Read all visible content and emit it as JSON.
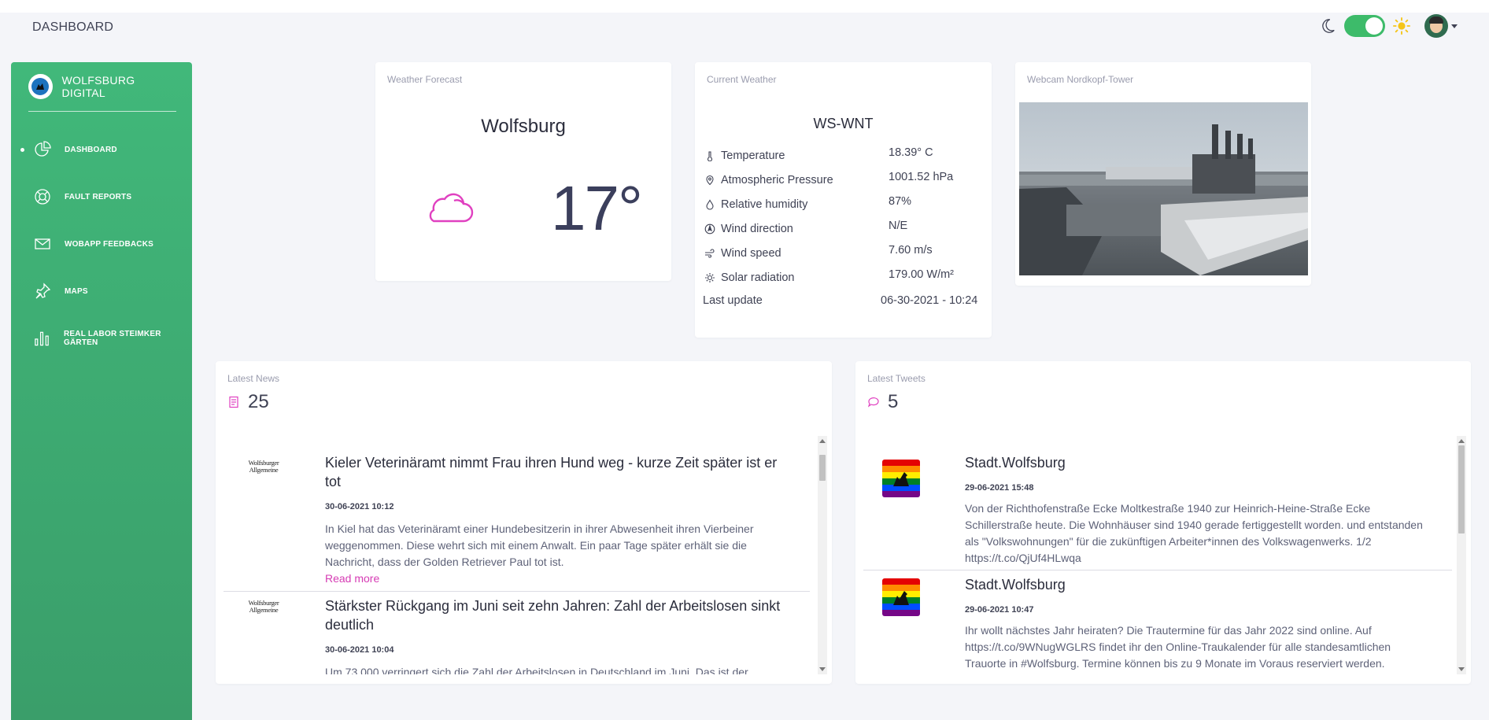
{
  "header": {
    "title": "DASHBOARD"
  },
  "sidebar": {
    "brand": "WOLFSBURG DIGITAL",
    "items": [
      {
        "label": "DASHBOARD",
        "icon": "pie-chart-icon",
        "active": true
      },
      {
        "label": "FAULT REPORTS",
        "icon": "lifebuoy-icon"
      },
      {
        "label": "WOBAPP FEEDBACKS",
        "icon": "envelope-icon"
      },
      {
        "label": "MAPS",
        "icon": "pin-icon"
      },
      {
        "label": "REAL LABOR STEIMKER GÄRTEN",
        "icon": "bar-chart-icon"
      }
    ]
  },
  "forecast": {
    "title": "Weather Forecast",
    "city": "Wolfsburg",
    "temp": "17°",
    "icon": "cloud-icon"
  },
  "current": {
    "title": "Current Weather",
    "station": "WS-WNT",
    "rows": [
      {
        "label": "Temperature",
        "value": "18.39° C",
        "icon": "thermometer-icon"
      },
      {
        "label": "Atmospheric Pressure",
        "value": "1001.52 hPa",
        "icon": "pressure-icon"
      },
      {
        "label": "Relative humidity",
        "value": "87%",
        "icon": "droplet-icon"
      },
      {
        "label": "Wind direction",
        "value": "N/E",
        "icon": "compass-icon"
      },
      {
        "label": "Wind speed",
        "value": "7.60 m/s",
        "icon": "wind-icon"
      },
      {
        "label": "Solar radiation",
        "value": "179.00 W/m²",
        "icon": "sun-icon"
      }
    ],
    "last_update_label": "Last update",
    "last_update_value": "06-30-2021 - 10:24"
  },
  "webcam": {
    "title": "Webcam Nordkopf-Tower"
  },
  "news": {
    "title": "Latest News",
    "count": "25",
    "items": [
      {
        "source": "Wolfsburger Allgemeine",
        "headline": "Kieler Veterinäramt nimmt Frau ihren Hund weg - kurze Zeit später ist er tot",
        "date": "30-06-2021 10:12",
        "text": "In Kiel hat das Veterinäramt einer Hundebesitzerin in ihrer Abwesenheit ihren Vierbeiner weggenommen. Diese wehrt sich mit einem Anwalt. Ein paar Tage später erhält sie die Nachricht, dass der Golden Retriever Paul tot ist.",
        "read_more": "Read more"
      },
      {
        "source": "Wolfsburger Allgemeine",
        "headline": "Stärkster Rückgang im Juni seit zehn Jahren: Zahl der Arbeitslosen sinkt deutlich",
        "date": "30-06-2021 10:04",
        "text": "Um 73.000 verringert sich die Zahl der Arbeitslosen in Deutschland im Juni. Das ist der",
        "read_more": ""
      }
    ],
    "scroll_position": 0.05
  },
  "tweets": {
    "title": "Latest Tweets",
    "count": "5",
    "items": [
      {
        "user": "Stadt.Wolfsburg",
        "date": "29-06-2021 15:48",
        "text": "Von der Richthofenstraße Ecke Moltkestraße 1940 zur Heinrich-Heine-Straße Ecke Schillerstraße heute. Die Wohnhäuser sind 1940 gerade fertiggestellt worden. und entstanden als \"Volkswohnungen\" für die zukünftigen Arbeiter*innen des Volkswagenwerks. 1/2 https://t.co/QjUf4HLwqa"
      },
      {
        "user": "Stadt.Wolfsburg",
        "date": "29-06-2021 10:47",
        "text": "Ihr wollt nächstes Jahr heiraten? Die Trautermine für das Jahr 2022 sind online. Auf https://t.co/9WNugWGLRS findet ihr den Online-Traukalender für alle standesamtlichen Trauorte in #Wolfsburg. Termine können bis zu 9 Monate im Voraus reserviert werden."
      }
    ],
    "scroll_position": 0.0
  },
  "colors": {
    "sidebar_green": "#41b87a",
    "accent_pink": "#d63cb4",
    "toggle_green": "#3dbb6a"
  }
}
